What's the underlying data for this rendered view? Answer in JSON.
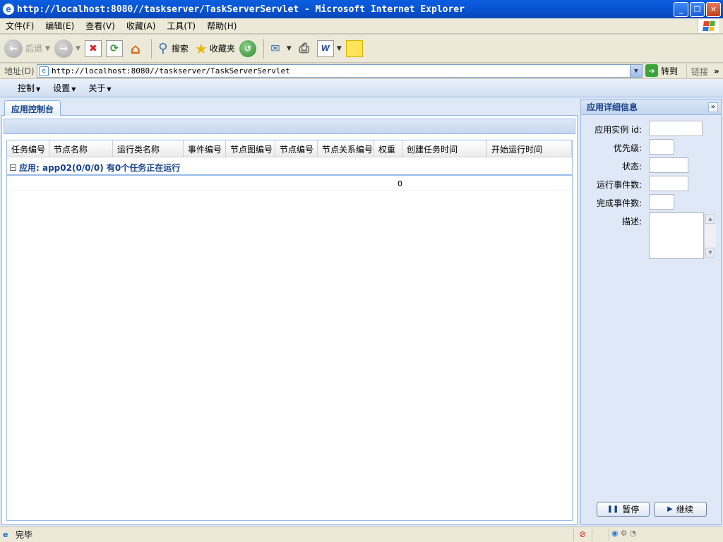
{
  "window": {
    "title": "http://localhost:8080//taskserver/TaskServerServlet - Microsoft Internet Explorer",
    "minimize": "_",
    "restore": "❐",
    "close": "✕"
  },
  "menu": [
    "文件(F)",
    "编辑(E)",
    "查看(V)",
    "收藏(A)",
    "工具(T)",
    "帮助(H)"
  ],
  "toolbar": {
    "back": "后退",
    "search": "搜索",
    "favorites": "收藏夹"
  },
  "address": {
    "label": "地址(D)",
    "url": "http://localhost:8080//taskserver/TaskServerServlet",
    "go": "转到",
    "links": "链接",
    "more": "»"
  },
  "app_menu": [
    "控制",
    "设置",
    "关于"
  ],
  "tabs": [
    "应用控制台"
  ],
  "grid": {
    "columns": [
      "任务编号",
      "节点名称",
      "运行类名称",
      "事件编号",
      "节点图编号",
      "节点编号",
      "节点关系编号",
      "权重",
      "创建任务时间",
      "开始运行时间"
    ],
    "group_label": "应用: app02(0/0/0) 有0个任务正在运行",
    "group_toggle": "−",
    "rows": [
      {
        "weight": "0"
      }
    ]
  },
  "details": {
    "title": "应用详细信息",
    "collapse": "»",
    "fields": {
      "instance_id": "应用实例 id:",
      "priority": "优先级:",
      "status": "状态:",
      "running_events": "运行事件数:",
      "completed_events": "完成事件数:",
      "description": "描述:"
    },
    "pause": "暂停",
    "resume": "继续"
  },
  "status": {
    "text": "完毕"
  },
  "colors": {
    "titlebar": "#0851cf",
    "panel_header": "#15428b",
    "panel_border": "#99bbe8"
  }
}
